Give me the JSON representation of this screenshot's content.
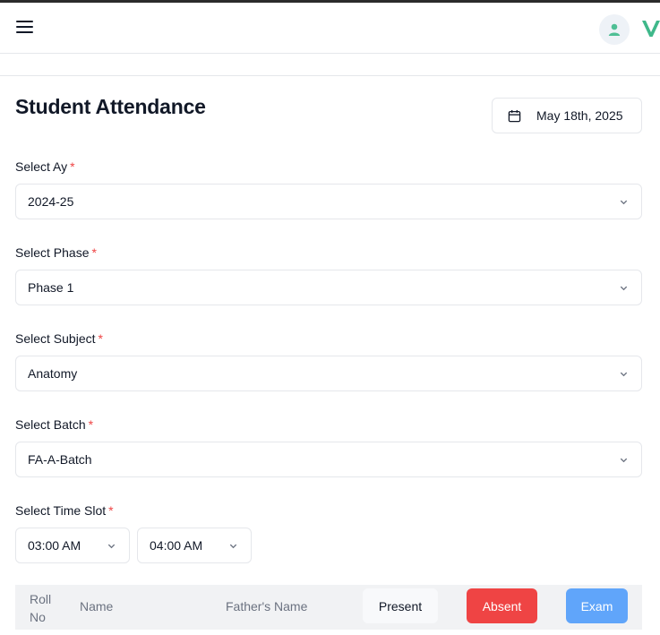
{
  "header": {
    "menu_icon": "hamburger-menu-icon",
    "avatar_icon": "user-icon",
    "logo_icon": "v-logo-icon",
    "colors": {
      "logo": "#3fb88a",
      "avatar_bg": "#eef2f7",
      "avatar_fg": "#4fbf95"
    }
  },
  "page": {
    "title": "Student Attendance",
    "date": "May 18th, 2025",
    "date_icon": "calendar-icon"
  },
  "form": {
    "ay": {
      "label": "Select Ay",
      "required": "*",
      "value": "2024-25"
    },
    "phase": {
      "label": "Select Phase",
      "required": "*",
      "value": "Phase 1"
    },
    "subject": {
      "label": "Select Subject",
      "required": "*",
      "value": "Anatomy"
    },
    "batch": {
      "label": "Select Batch",
      "required": "*",
      "value": "FA-A-Batch"
    },
    "timeslot": {
      "label": "Select Time Slot",
      "required": "*",
      "start": "03:00 AM",
      "end": "04:00 AM"
    }
  },
  "table": {
    "columns": {
      "roll_line1": "Roll",
      "roll_line2": "No",
      "name": "Name",
      "father": "Father's Name"
    },
    "actions": {
      "present": "Present",
      "absent": "Absent",
      "exam": "Exam"
    },
    "colors": {
      "absent": "#ef4444",
      "exam": "#60a5fa",
      "required": "#ef4444"
    }
  }
}
